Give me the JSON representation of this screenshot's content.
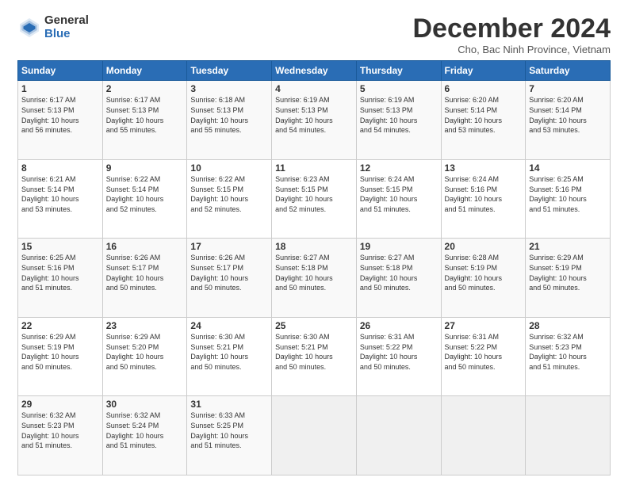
{
  "logo": {
    "general": "General",
    "blue": "Blue"
  },
  "header": {
    "month": "December 2024",
    "location": "Cho, Bac Ninh Province, Vietnam"
  },
  "weekdays": [
    "Sunday",
    "Monday",
    "Tuesday",
    "Wednesday",
    "Thursday",
    "Friday",
    "Saturday"
  ],
  "weeks": [
    [
      {
        "day": "1",
        "sunrise": "6:17 AM",
        "sunset": "5:13 PM",
        "daylight": "10 hours and 56 minutes."
      },
      {
        "day": "2",
        "sunrise": "6:17 AM",
        "sunset": "5:13 PM",
        "daylight": "10 hours and 55 minutes."
      },
      {
        "day": "3",
        "sunrise": "6:18 AM",
        "sunset": "5:13 PM",
        "daylight": "10 hours and 55 minutes."
      },
      {
        "day": "4",
        "sunrise": "6:19 AM",
        "sunset": "5:13 PM",
        "daylight": "10 hours and 54 minutes."
      },
      {
        "day": "5",
        "sunrise": "6:19 AM",
        "sunset": "5:13 PM",
        "daylight": "10 hours and 54 minutes."
      },
      {
        "day": "6",
        "sunrise": "6:20 AM",
        "sunset": "5:14 PM",
        "daylight": "10 hours and 53 minutes."
      },
      {
        "day": "7",
        "sunrise": "6:20 AM",
        "sunset": "5:14 PM",
        "daylight": "10 hours and 53 minutes."
      }
    ],
    [
      {
        "day": "8",
        "sunrise": "6:21 AM",
        "sunset": "5:14 PM",
        "daylight": "10 hours and 53 minutes."
      },
      {
        "day": "9",
        "sunrise": "6:22 AM",
        "sunset": "5:14 PM",
        "daylight": "10 hours and 52 minutes."
      },
      {
        "day": "10",
        "sunrise": "6:22 AM",
        "sunset": "5:15 PM",
        "daylight": "10 hours and 52 minutes."
      },
      {
        "day": "11",
        "sunrise": "6:23 AM",
        "sunset": "5:15 PM",
        "daylight": "10 hours and 52 minutes."
      },
      {
        "day": "12",
        "sunrise": "6:24 AM",
        "sunset": "5:15 PM",
        "daylight": "10 hours and 51 minutes."
      },
      {
        "day": "13",
        "sunrise": "6:24 AM",
        "sunset": "5:16 PM",
        "daylight": "10 hours and 51 minutes."
      },
      {
        "day": "14",
        "sunrise": "6:25 AM",
        "sunset": "5:16 PM",
        "daylight": "10 hours and 51 minutes."
      }
    ],
    [
      {
        "day": "15",
        "sunrise": "6:25 AM",
        "sunset": "5:16 PM",
        "daylight": "10 hours and 51 minutes."
      },
      {
        "day": "16",
        "sunrise": "6:26 AM",
        "sunset": "5:17 PM",
        "daylight": "10 hours and 50 minutes."
      },
      {
        "day": "17",
        "sunrise": "6:26 AM",
        "sunset": "5:17 PM",
        "daylight": "10 hours and 50 minutes."
      },
      {
        "day": "18",
        "sunrise": "6:27 AM",
        "sunset": "5:18 PM",
        "daylight": "10 hours and 50 minutes."
      },
      {
        "day": "19",
        "sunrise": "6:27 AM",
        "sunset": "5:18 PM",
        "daylight": "10 hours and 50 minutes."
      },
      {
        "day": "20",
        "sunrise": "6:28 AM",
        "sunset": "5:19 PM",
        "daylight": "10 hours and 50 minutes."
      },
      {
        "day": "21",
        "sunrise": "6:29 AM",
        "sunset": "5:19 PM",
        "daylight": "10 hours and 50 minutes."
      }
    ],
    [
      {
        "day": "22",
        "sunrise": "6:29 AM",
        "sunset": "5:19 PM",
        "daylight": "10 hours and 50 minutes."
      },
      {
        "day": "23",
        "sunrise": "6:29 AM",
        "sunset": "5:20 PM",
        "daylight": "10 hours and 50 minutes."
      },
      {
        "day": "24",
        "sunrise": "6:30 AM",
        "sunset": "5:21 PM",
        "daylight": "10 hours and 50 minutes."
      },
      {
        "day": "25",
        "sunrise": "6:30 AM",
        "sunset": "5:21 PM",
        "daylight": "10 hours and 50 minutes."
      },
      {
        "day": "26",
        "sunrise": "6:31 AM",
        "sunset": "5:22 PM",
        "daylight": "10 hours and 50 minutes."
      },
      {
        "day": "27",
        "sunrise": "6:31 AM",
        "sunset": "5:22 PM",
        "daylight": "10 hours and 50 minutes."
      },
      {
        "day": "28",
        "sunrise": "6:32 AM",
        "sunset": "5:23 PM",
        "daylight": "10 hours and 51 minutes."
      }
    ],
    [
      {
        "day": "29",
        "sunrise": "6:32 AM",
        "sunset": "5:23 PM",
        "daylight": "10 hours and 51 minutes."
      },
      {
        "day": "30",
        "sunrise": "6:32 AM",
        "sunset": "5:24 PM",
        "daylight": "10 hours and 51 minutes."
      },
      {
        "day": "31",
        "sunrise": "6:33 AM",
        "sunset": "5:25 PM",
        "daylight": "10 hours and 51 minutes."
      },
      null,
      null,
      null,
      null
    ]
  ]
}
